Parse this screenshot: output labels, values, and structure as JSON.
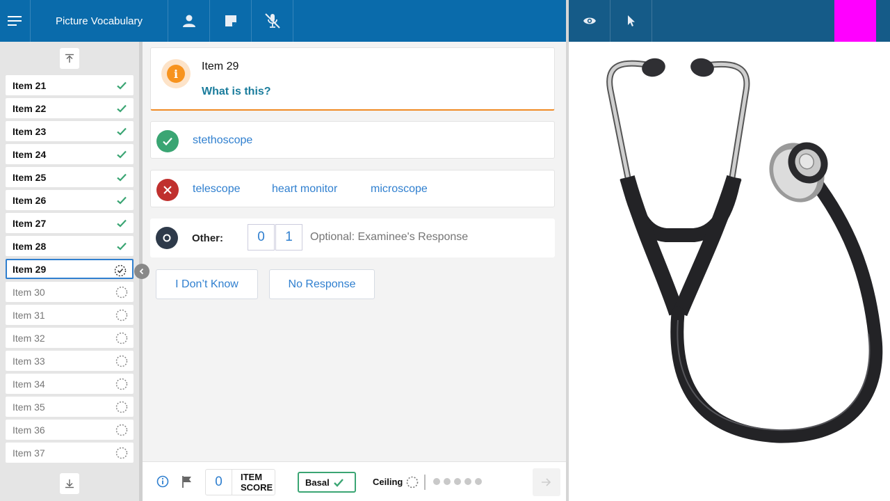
{
  "header": {
    "title": "Picture Vocabulary"
  },
  "sidebar": {
    "items": [
      {
        "label": "Item 21",
        "status": "complete"
      },
      {
        "label": "Item 22",
        "status": "complete"
      },
      {
        "label": "Item 23",
        "status": "complete"
      },
      {
        "label": "Item 24",
        "status": "complete"
      },
      {
        "label": "Item 25",
        "status": "complete"
      },
      {
        "label": "Item 26",
        "status": "complete"
      },
      {
        "label": "Item 27",
        "status": "complete"
      },
      {
        "label": "Item 28",
        "status": "complete"
      },
      {
        "label": "Item 29",
        "status": "current"
      },
      {
        "label": "Item 30",
        "status": "pending"
      },
      {
        "label": "Item 31",
        "status": "pending"
      },
      {
        "label": "Item 32",
        "status": "pending"
      },
      {
        "label": "Item 33",
        "status": "pending"
      },
      {
        "label": "Item 34",
        "status": "pending"
      },
      {
        "label": "Item 35",
        "status": "pending"
      },
      {
        "label": "Item 36",
        "status": "pending"
      },
      {
        "label": "Item 37",
        "status": "pending"
      }
    ]
  },
  "item": {
    "title": "Item 29",
    "question": "What is this?",
    "correct_responses": [
      "stethoscope"
    ],
    "incorrect_responses": [
      "telescope",
      "heart monitor",
      "microscope"
    ],
    "other_label": "Other:",
    "score_options": [
      "0",
      "1"
    ],
    "response_placeholder": "Optional: Examinee's Response"
  },
  "actions": {
    "dont_know": "I Don’t Know",
    "no_response": "No Response"
  },
  "bottom": {
    "item_score_value": "0",
    "item_score_label_1": "ITEM",
    "item_score_label_2": "SCORE",
    "basal_label": "Basal",
    "ceiling_label": "Ceiling"
  },
  "colors": {
    "header_blue": "#0a6bab",
    "header_dark_blue": "#155b88",
    "accent_orange": "#f7931e",
    "correct_green": "#3aa573",
    "incorrect_red": "#c0302e",
    "link_blue": "#2f7fcf",
    "marker_magenta": "#ff00ff"
  },
  "stimulus": {
    "image": "stethoscope-picture"
  }
}
